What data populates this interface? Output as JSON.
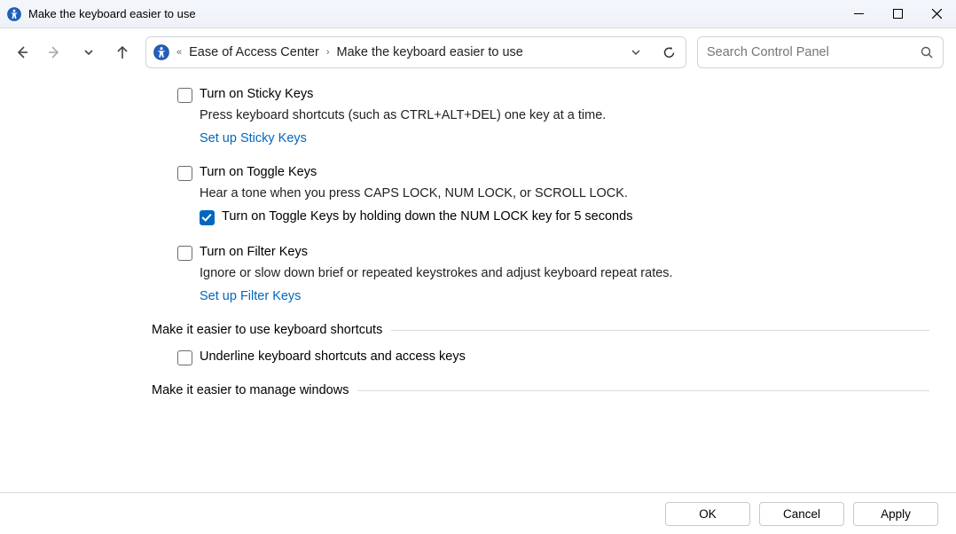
{
  "window": {
    "title": "Make the keyboard easier to use"
  },
  "breadcrumb": {
    "parent": "Ease of Access Center",
    "current": "Make the keyboard easier to use"
  },
  "search": {
    "placeholder": "Search Control Panel"
  },
  "options": {
    "sticky": {
      "label": "Turn on Sticky Keys",
      "desc": "Press keyboard shortcuts (such as CTRL+ALT+DEL) one key at a time.",
      "link": "Set up Sticky Keys",
      "checked": false
    },
    "toggle": {
      "label": "Turn on Toggle Keys",
      "desc": "Hear a tone when you press CAPS LOCK, NUM LOCK, or SCROLL LOCK.",
      "sub_label": "Turn on Toggle Keys by holding down the NUM LOCK key for 5 seconds",
      "checked": false,
      "sub_checked": true
    },
    "filter": {
      "label": "Turn on Filter Keys",
      "desc": "Ignore or slow down brief or repeated keystrokes and adjust keyboard repeat rates.",
      "link": "Set up Filter Keys",
      "checked": false
    }
  },
  "sections": {
    "shortcuts": {
      "title": "Make it easier to use keyboard shortcuts",
      "underline": {
        "label": "Underline keyboard shortcuts and access keys",
        "checked": false
      }
    },
    "windows": {
      "title": "Make it easier to manage windows"
    }
  },
  "footer": {
    "ok": "OK",
    "cancel": "Cancel",
    "apply": "Apply"
  }
}
